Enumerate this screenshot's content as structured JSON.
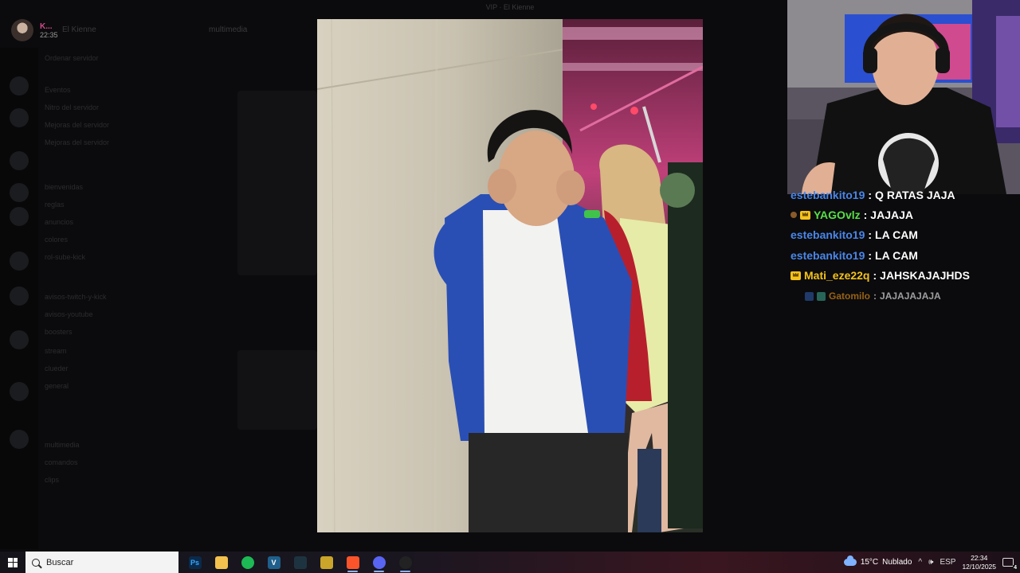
{
  "discord_background": {
    "window_title": "VIP · El Kienne",
    "user": {
      "name": "K...",
      "time": "22:35"
    },
    "server_title": "El Kienne",
    "channel_title": "multimedia",
    "channels": [
      "Ordenar servidor",
      "Eventos",
      "Nitro del servidor",
      "Mejoras del servidor",
      "bienvenidas",
      "reglas",
      "anuncios",
      "colores",
      "rol-sube-kick",
      "avisos-twitch-y-kick",
      "avisos-youtube",
      "boosters",
      "stream",
      "clueder",
      "general",
      "multimedia",
      "comandos",
      "clips"
    ]
  },
  "stream_chat": [
    {
      "user": "estebankito19",
      "text": "Q RATAS JAJA",
      "color": "#4a86e8",
      "badges": []
    },
    {
      "user": "YAGOvlz",
      "text": "JAJAJA",
      "color": "#57e046",
      "badges": [
        "small",
        "crown"
      ]
    },
    {
      "user": "estebankito19",
      "text": "LA CAM",
      "color": "#4a86e8",
      "badges": []
    },
    {
      "user": "estebankito19",
      "text": "LA CAM",
      "color": "#4a86e8",
      "badges": []
    },
    {
      "user": "Mati_eze22q",
      "text": "JAHSKAJAJHDS",
      "color": "#f4c21b",
      "badges": [
        "crown"
      ]
    },
    {
      "user": "Gatomilo",
      "text": "JAJAJAJAJA",
      "color": "#f49b1b",
      "badges": [
        "a",
        "b"
      ]
    }
  ],
  "taskbar": {
    "search_placeholder": "Buscar",
    "apps": [
      {
        "name": "photoshop",
        "glyph": "Ps",
        "bg": "#0b2a4a",
        "fg": "#33a8ff"
      },
      {
        "name": "file-explorer",
        "glyph": "",
        "bg": "#f2c14e",
        "fg": "#8a5a00"
      },
      {
        "name": "spotify",
        "glyph": "",
        "bg": "#1db954",
        "fg": "#000"
      },
      {
        "name": "vegas",
        "glyph": "V",
        "bg": "#1f5f8b",
        "fg": "#fff"
      },
      {
        "name": "game-launcher",
        "glyph": "",
        "bg": "#1e3340",
        "fg": "#6fd3ff"
      },
      {
        "name": "valorant",
        "glyph": "",
        "bg": "#caa52a",
        "fg": "#7a1f1f"
      },
      {
        "name": "brave",
        "glyph": "",
        "bg": "#fb542b",
        "fg": "#fff"
      },
      {
        "name": "discord",
        "glyph": "",
        "bg": "#5865f2",
        "fg": "#fff"
      },
      {
        "name": "obs",
        "glyph": "",
        "bg": "#222",
        "fg": "#ddd"
      }
    ],
    "weather": {
      "temp": "15°C",
      "condition": "Nublado"
    },
    "language": "ESP",
    "time": "22:34",
    "date": "12/10/2025",
    "notifications": "4"
  }
}
